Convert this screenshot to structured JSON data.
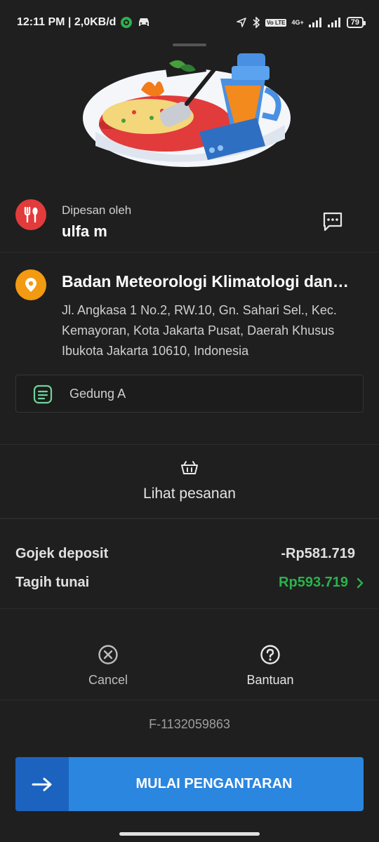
{
  "status_bar": {
    "time_speed": "12:11 PM | 2,0KB/d",
    "net_label": "4G+",
    "lte_label": "Vo LTE",
    "battery": "79"
  },
  "order": {
    "ordered_by_label": "Dipesan oleh",
    "customer_name": "ulfa m"
  },
  "destination": {
    "title": "Badan Meteorologi Klimatologi dan…",
    "address": "Jl. Angkasa 1 No.2, RW.10, Gn. Sahari Sel., Kec. Kemayoran, Kota Jakarta Pusat, Daerah Khusus Ibukota Jakarta 10610, Indonesia",
    "note": "Gedung A"
  },
  "view_order": {
    "label": "Lihat pesanan"
  },
  "payment": {
    "rows": [
      {
        "label": "Gojek deposit",
        "value": "-Rp581.719"
      },
      {
        "label": "Tagih tunai",
        "value": "Rp593.719"
      }
    ]
  },
  "actions": {
    "cancel_label": "Cancel",
    "help_label": "Bantuan"
  },
  "order_id": "F-1132059863",
  "cta": {
    "label": "MULAI PENGANTARAN"
  },
  "colors": {
    "background": "#1f1f1f",
    "restaurant_icon": "#e23b3b",
    "location_icon": "#f29a12",
    "cash_green": "#2bb24c",
    "cta_blue": "#2a86de",
    "cta_dark_blue": "#1b63bf"
  },
  "icons": {
    "restaurant": "fork-spoon-icon",
    "chat": "chat-bubble-icon",
    "location": "location-pin-icon",
    "note": "note-icon",
    "basket": "basket-icon",
    "cancel": "cancel-circle-icon",
    "help": "help-circle-icon",
    "cta": "arrow-right-icon"
  }
}
